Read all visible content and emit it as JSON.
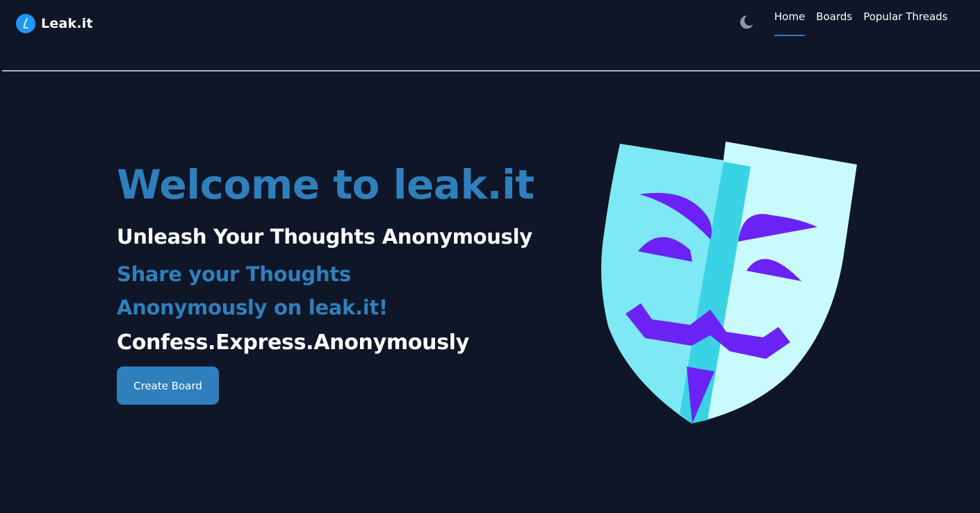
{
  "header": {
    "brand_name": "Leak.it",
    "logo_letter": "L",
    "nav": [
      "Home",
      "Boards",
      "Popular Threads"
    ],
    "active_nav": "Home",
    "theme_icon": "moon-icon"
  },
  "hero": {
    "title": "Welcome to leak.it",
    "subtitle": "Unleash Your Thoughts Anonymously",
    "tagline": "Share your Thoughts Anonymously on leak.it!",
    "slogan": "Confess.Express.Anonymously",
    "button_label": "Create Board",
    "illustration_icon": "anonymous-mask-icon"
  },
  "colors": {
    "background": "#0e1628",
    "accent": "#2f7fbd",
    "logo": "#2196f3",
    "mask_light": "#7ee8f5",
    "mask_lighter": "#c9fbfd",
    "mask_stripe": "#3ad3e6",
    "mask_features": "#6b22f5"
  }
}
